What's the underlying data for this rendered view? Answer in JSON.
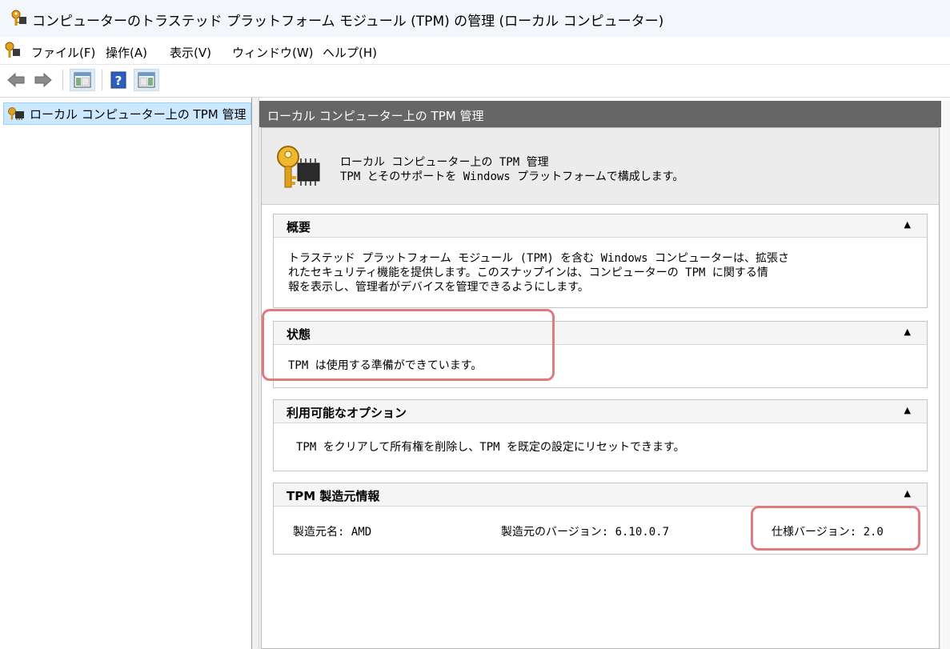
{
  "window": {
    "title": "コンピューターのトラステッド プラットフォーム モジュール (TPM) の管理 (ローカル コンピューター)"
  },
  "menu": [
    "ファイル(F)",
    "操作(A)",
    "表示(V)",
    "ウィンドウ(W)",
    "ヘルプ(H)"
  ],
  "toolbar": {
    "buttons": [
      "back-arrow",
      "forward-arrow",
      "show-hide-console-tree",
      "help",
      "show-hide-action-pane"
    ]
  },
  "tree": {
    "selected_item": "ローカル コンピューター上の TPM 管理"
  },
  "pane": {
    "header": "ローカル コンピューター上の TPM 管理",
    "banner_title": "ローカル コンピューター上の TPM 管理",
    "banner_subtitle": "TPM とそのサポートを Windows プラットフォームで構成します。"
  },
  "sections": {
    "overview": {
      "title": "概要",
      "lines": [
        "トラステッド プラットフォーム モジュール (TPM) を含む Windows コンピューターは、拡張さ",
        "れたセキュリティ機能を提供します。このスナップインは、コンピューターの TPM に関する情",
        "報を表示し、管理者がデバイスを管理できるようにします。"
      ]
    },
    "status": {
      "title": "状態",
      "text": "TPM は使用する準備ができています。"
    },
    "options": {
      "title": "利用可能なオプション",
      "text": "TPM をクリアして所有権を削除し、TPM を既定の設定にリセットできます。"
    },
    "manufacturer": {
      "title": "TPM 製造元情報",
      "name": "製造元名: AMD",
      "version": "製造元のバージョン: 6.10.0.7",
      "spec": "仕様バージョン: 2.0"
    }
  },
  "colors": {
    "highlight": "#e07a80",
    "selection": "#cce8ff",
    "pane_header": "#666666"
  }
}
